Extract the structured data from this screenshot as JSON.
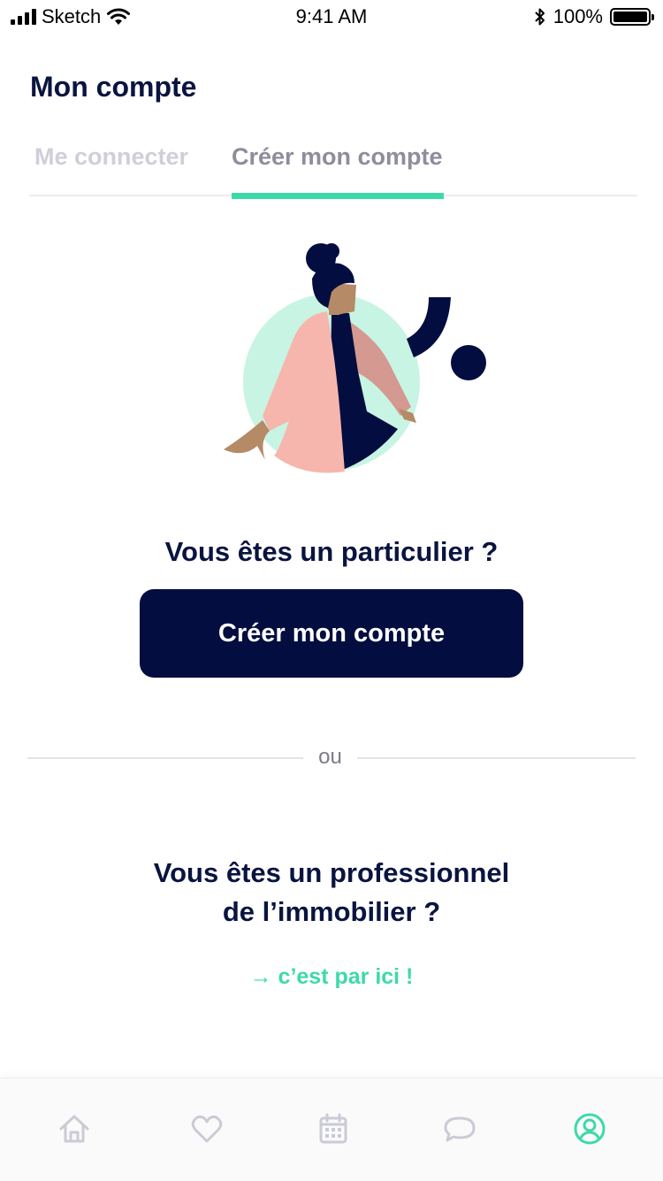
{
  "status_bar": {
    "carrier": "Sketch",
    "time": "9:41 AM",
    "battery": "100%",
    "battery_level": 1.0,
    "icons": [
      "signal-icon",
      "wifi-icon",
      "bluetooth-icon",
      "battery-icon"
    ]
  },
  "header": {
    "title": "Mon compte"
  },
  "tabs": [
    {
      "label": "Me connecter",
      "active": false
    },
    {
      "label": "Créer mon compte",
      "active": true
    }
  ],
  "particulier": {
    "question": "Vous êtes un particulier ?",
    "button_label": "Créer mon compte"
  },
  "divider": {
    "label": "ou"
  },
  "professionnel": {
    "question_line1": "Vous êtes un professionnel",
    "question_line2": "de l’immobilier ?",
    "link_label": "→ c’est par ici !"
  },
  "bottom_nav": {
    "items": [
      {
        "icon": "home-icon",
        "active": false
      },
      {
        "icon": "heart-icon",
        "active": false
      },
      {
        "icon": "calendar-icon",
        "active": false
      },
      {
        "icon": "chat-icon",
        "active": false
      },
      {
        "icon": "account-icon",
        "active": true
      }
    ]
  },
  "colors": {
    "primary_dark": "#030d3f",
    "accent": "#3dd9a9",
    "text": "#0a1440",
    "inactive_tab": "#cfcfda",
    "inactive_icon": "#cbcbd6"
  }
}
